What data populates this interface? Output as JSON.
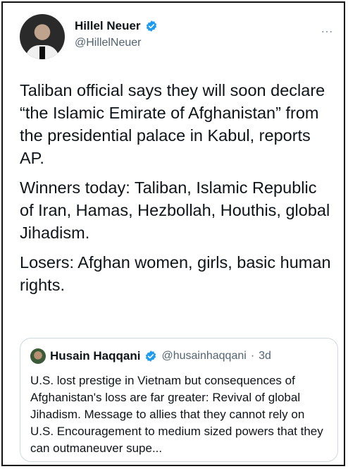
{
  "author": {
    "name": "Hillel Neuer",
    "handle": "@HillelNeuer"
  },
  "tweet": {
    "paragraphs": [
      "Taliban official says they will soon declare “the Islamic Emirate of Afghanistan” from the presidential palace in Kabul, reports AP.",
      "Winners today: Taliban, Islamic Republic of Iran, Hamas, Hezbollah, Houthis, global Jihadism.",
      "Losers: Afghan women, girls, basic human rights."
    ]
  },
  "more_icon": "…",
  "quote": {
    "name": "Husain Haqqani",
    "handle": "@husainhaqqani",
    "dot": "·",
    "time": "3d",
    "text": "U.S. lost prestige in Vietnam but consequences of Afghanistan's loss are far greater: Revival of global Jihadism. Message to allies that they cannot rely on U.S. Encouragement to medium sized powers that they can outmaneuver  supe..."
  },
  "colors": {
    "verified": "#1d9bf0",
    "secondary_text": "#536471",
    "border": "#cfd9de"
  }
}
